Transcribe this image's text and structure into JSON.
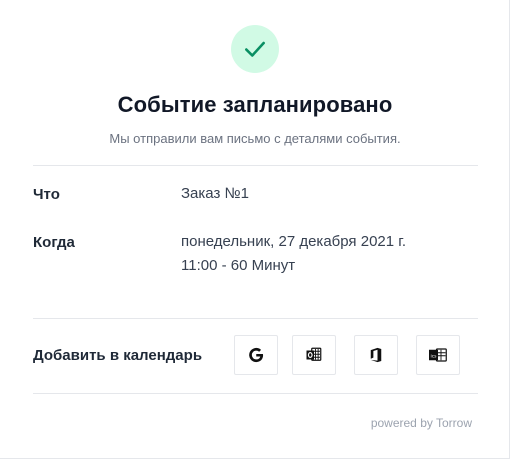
{
  "header": {
    "icon": "check-icon",
    "accent_color": "#0a8f63",
    "icon_bg_color": "#d1fae5",
    "title": "Событие запланировано",
    "subtitle": "Мы отправили вам письмо с деталями события."
  },
  "details": {
    "what_label": "Что",
    "what_value": "Заказ №1",
    "when_label": "Когда",
    "when_date": "понедельник, 27 декабря 2021 г.",
    "when_time": "11:00 - 60 Минут"
  },
  "calendar": {
    "label": "Добавить в календарь",
    "buttons": [
      {
        "icon": "google-calendar-icon"
      },
      {
        "icon": "outlook-calendar-icon"
      },
      {
        "icon": "office365-calendar-icon"
      },
      {
        "icon": "ics-calendar-icon"
      }
    ]
  },
  "footer": {
    "powered_by": "powered by Torrow"
  }
}
